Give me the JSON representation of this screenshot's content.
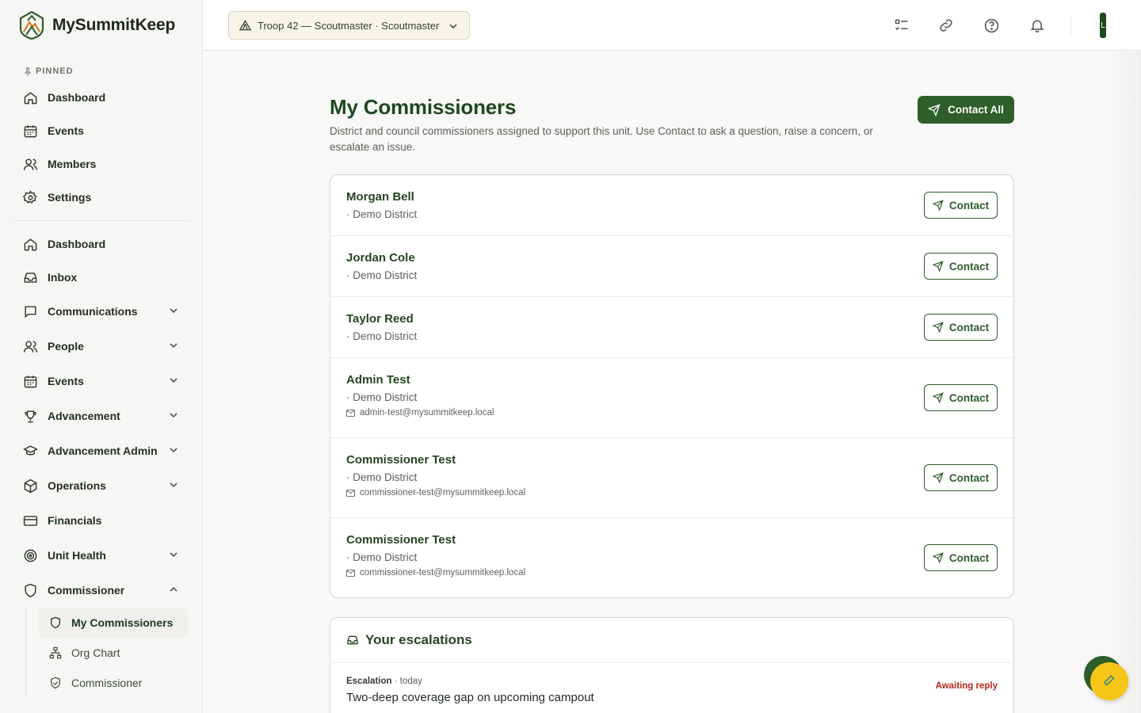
{
  "app": {
    "name": "MySummitKeep"
  },
  "sidebar": {
    "pinned_label": "PINNED",
    "pinned": [
      {
        "label": "Dashboard",
        "icon": "home-icon"
      },
      {
        "label": "Events",
        "icon": "calendar-icon"
      },
      {
        "label": "Members",
        "icon": "users-icon"
      },
      {
        "label": "Settings",
        "icon": "gear-icon"
      }
    ],
    "items": [
      {
        "label": "Dashboard",
        "icon": "home-icon",
        "expandable": false
      },
      {
        "label": "Inbox",
        "icon": "inbox-icon",
        "expandable": false
      },
      {
        "label": "Communications",
        "icon": "message-icon",
        "expandable": true
      },
      {
        "label": "People",
        "icon": "users-icon",
        "expandable": true
      },
      {
        "label": "Events",
        "icon": "calendar-icon",
        "expandable": true
      },
      {
        "label": "Advancement",
        "icon": "trophy-icon",
        "expandable": true
      },
      {
        "label": "Advancement Admin",
        "icon": "graduation-cap-icon",
        "expandable": true
      },
      {
        "label": "Operations",
        "icon": "box-icon",
        "expandable": true
      },
      {
        "label": "Financials",
        "icon": "credit-card-icon",
        "expandable": false
      },
      {
        "label": "Unit Health",
        "icon": "target-icon",
        "expandable": true
      },
      {
        "label": "Commissioner",
        "icon": "shield-icon",
        "expandable": true,
        "expanded": true
      }
    ],
    "sub_items": [
      {
        "label": "My Commissioners",
        "icon": "shield-icon",
        "active": true
      },
      {
        "label": "Org Chart",
        "icon": "org-chart-icon",
        "active": false
      },
      {
        "label": "Commissioner",
        "icon": "shield-check-icon",
        "active": false
      }
    ]
  },
  "topbar": {
    "unit_label": "Troop 42 — Scoutmaster · Scoutmaster",
    "avatar_initial": "L",
    "icons": [
      "checklist-icon",
      "link-icon",
      "help-icon",
      "bell-icon"
    ]
  },
  "main": {
    "title": "My Commissioners",
    "description": "District and council commissioners assigned to support this unit. Use Contact to ask a question, raise a concern, or escalate an issue.",
    "contact_all_label": "Contact All",
    "contact_label": "Contact",
    "commissioners": [
      {
        "name": "Morgan Bell",
        "district": "· Demo District",
        "email": ""
      },
      {
        "name": "Jordan Cole",
        "district": "· Demo District",
        "email": ""
      },
      {
        "name": "Taylor Reed",
        "district": "· Demo District",
        "email": ""
      },
      {
        "name": "Admin Test",
        "district": "· Demo District",
        "email": "admin-test@mysummitkeep.local"
      },
      {
        "name": "Commissioner Test",
        "district": "· Demo District",
        "email": "commissioner-test@mysummitkeep.local"
      },
      {
        "name": "Commissioner Test",
        "district": "· Demo District",
        "email": "commissioner-test@mysummitkeep.local"
      }
    ],
    "escalations": {
      "title": "Your escalations",
      "items": [
        {
          "type": "Escalation",
          "when": "· today",
          "title": "Two-deep coverage gap on upcoming campout",
          "status": "Awaiting reply"
        }
      ]
    }
  },
  "colors": {
    "brand_green": "#2e5e2a",
    "status_red": "#b3261e",
    "fab_yellow": "#f5c518"
  }
}
